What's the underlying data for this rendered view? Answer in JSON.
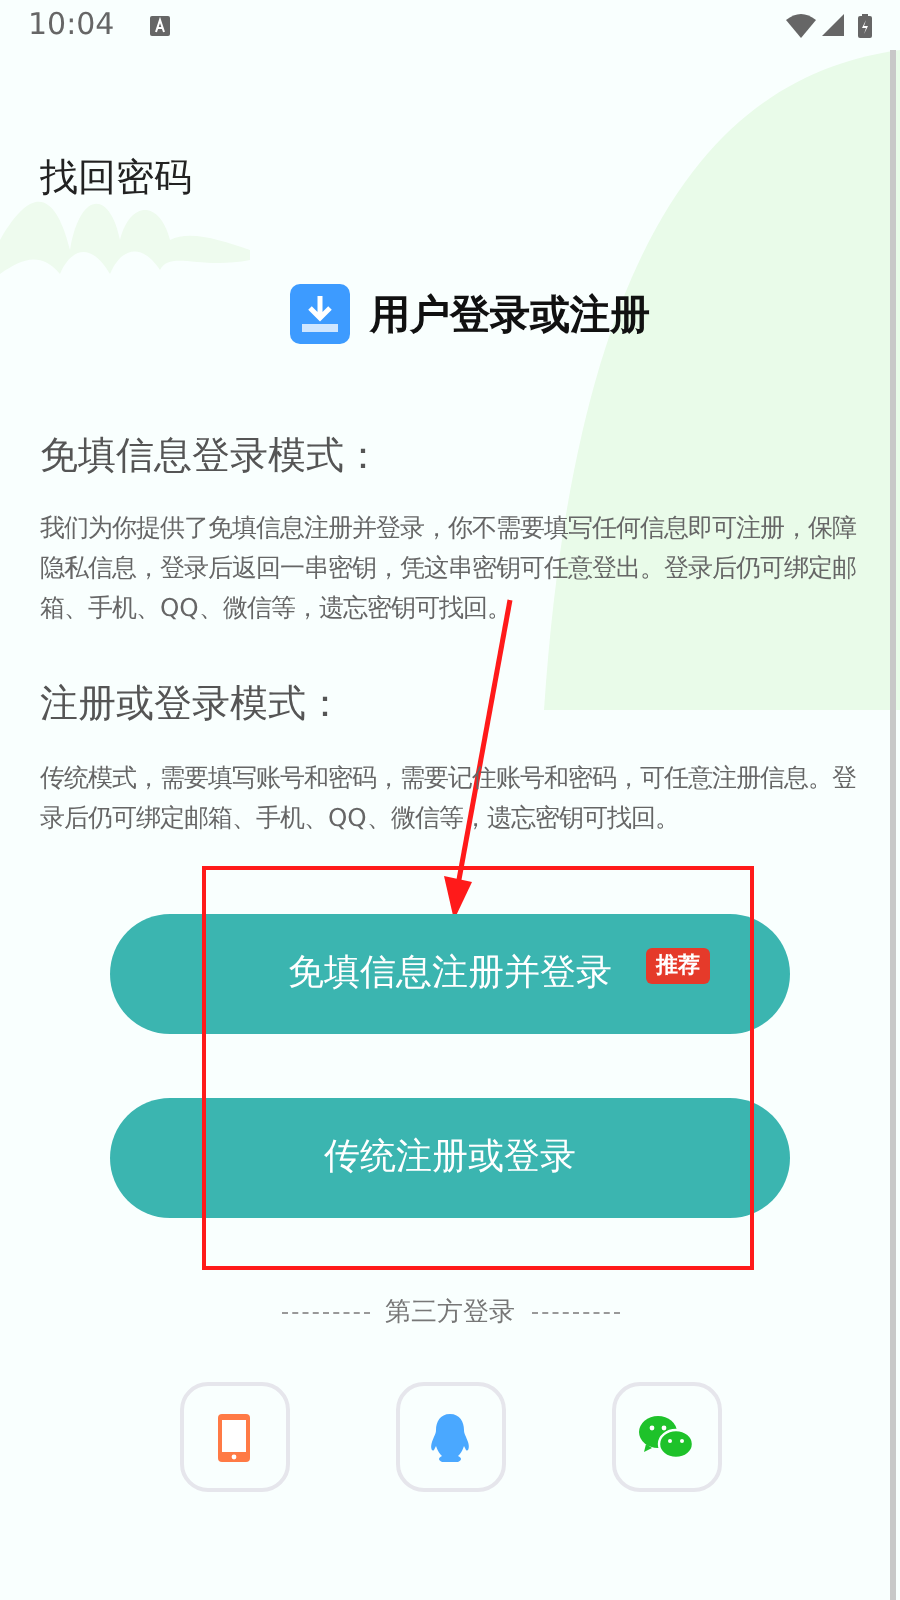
{
  "status_bar": {
    "time": "10:04"
  },
  "top_link": "找回密码",
  "header": {
    "title": "用户登录或注册"
  },
  "sections": [
    {
      "heading": "免填信息登录模式：",
      "body": "我们为你提供了免填信息注册并登录，你不需要填写任何信息即可注册，保障隐私信息，登录后返回一串密钥，凭这串密钥可任意登出。登录后仍可绑定邮箱、手机、QQ、微信等，遗忘密钥可找回。"
    },
    {
      "heading": "注册或登录模式：",
      "body": "传统模式，需要填写账号和密码，需要记住账号和密码，可任意注册信息。登录后仍可绑定邮箱、手机、QQ、微信等，遗忘密钥可找回。"
    }
  ],
  "buttons": [
    {
      "label": "免填信息注册并登录",
      "badge": "推荐"
    },
    {
      "label": "传统注册或登录"
    }
  ],
  "third_party": {
    "label": "第三方登录",
    "options": [
      {
        "kind": "phone"
      },
      {
        "kind": "qq"
      },
      {
        "kind": "wechat"
      }
    ]
  }
}
